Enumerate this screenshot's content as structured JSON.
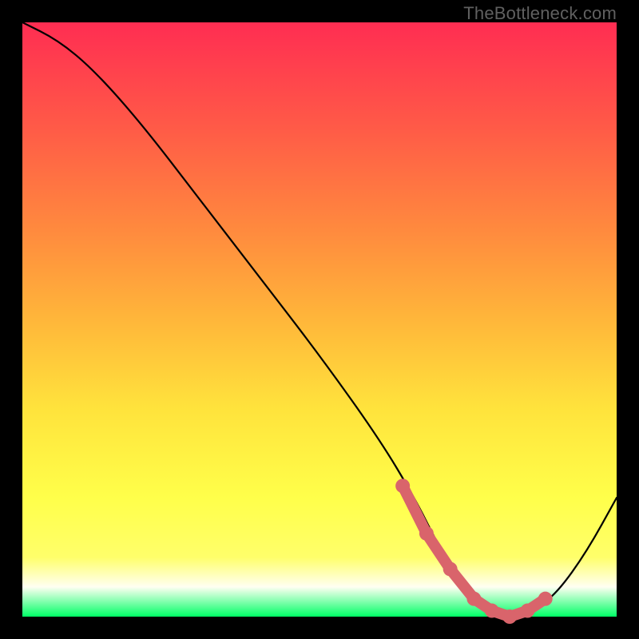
{
  "watermark": "TheBottleneck.com",
  "chart_data": {
    "type": "line",
    "title": "",
    "xlabel": "",
    "ylabel": "",
    "xlim": [
      0,
      100
    ],
    "ylim": [
      0,
      100
    ],
    "series": [
      {
        "name": "bottleneck-curve",
        "x": [
          0,
          6,
          12,
          20,
          30,
          40,
          50,
          60,
          66,
          70,
          74,
          78,
          82,
          86,
          90,
          95,
          100
        ],
        "values": [
          100,
          97,
          92,
          83,
          70,
          57,
          44,
          30,
          20,
          12,
          5,
          1,
          0,
          1,
          4,
          11,
          20
        ]
      }
    ],
    "markers": {
      "name": "optimal-range",
      "color": "#d9646b",
      "x": [
        64,
        68,
        72,
        76,
        79,
        82,
        85,
        88
      ],
      "values": [
        22,
        14,
        8,
        3,
        1,
        0,
        1,
        3
      ]
    }
  }
}
